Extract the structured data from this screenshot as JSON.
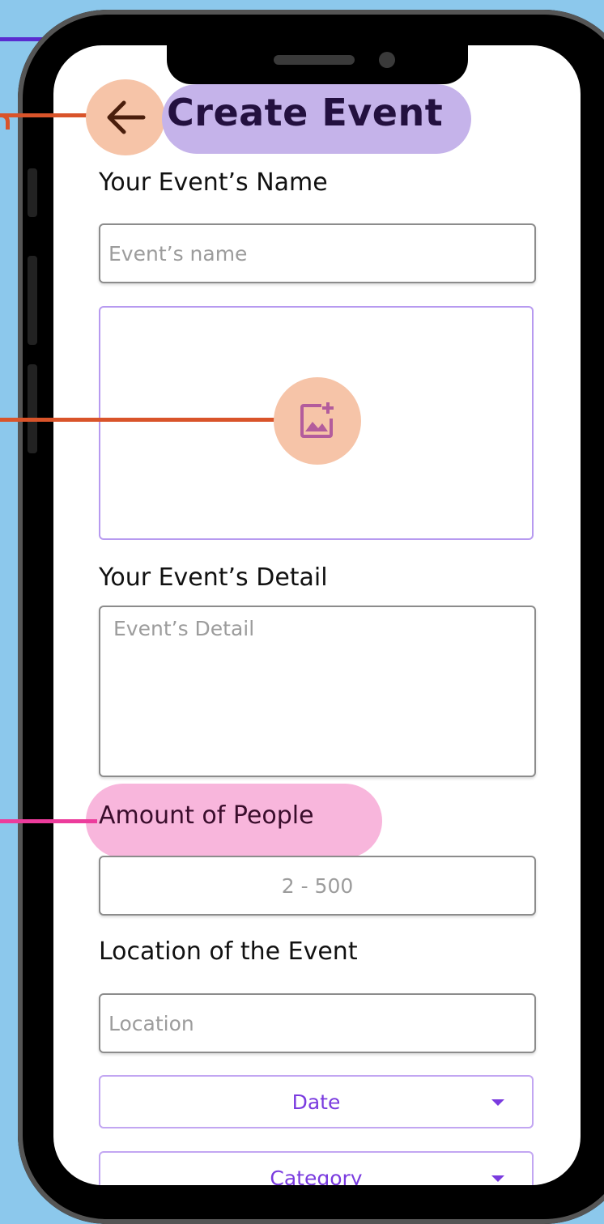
{
  "header": {
    "title": "Create Event"
  },
  "icons": {
    "back": "arrow-left-icon",
    "add_image": "add-photo-icon",
    "dropdown": "caret-down-icon"
  },
  "colors": {
    "accent": "#7a3bdf",
    "title_highlight": "#c5b3ea",
    "icon_highlight": "#f6c4a8",
    "label_highlight": "#f8b6dc"
  },
  "form": {
    "name_label": "Your Event’s Name",
    "name_placeholder": "Event’s name",
    "detail_label": "Your Event’s Detail",
    "detail_placeholder": "Event’s Detail",
    "people_label": "Amount of People",
    "people_placeholder": "2 - 500",
    "location_label": "Location of the Event",
    "location_placeholder": "Location",
    "date_select": "Date",
    "category_select": "Category"
  }
}
